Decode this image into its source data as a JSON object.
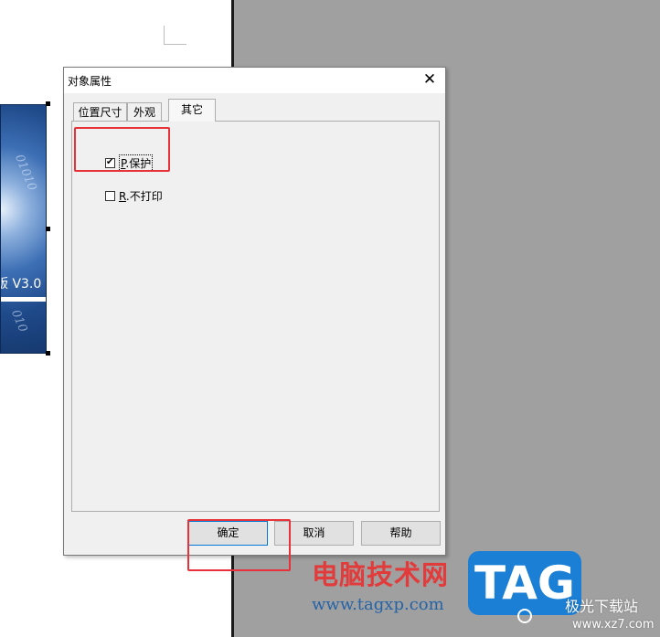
{
  "canvas": {
    "image_version_text": "版 V3.0",
    "image_digits_1": "01010",
    "image_digits_2": "010"
  },
  "dialog": {
    "title": "对象属性",
    "close_glyph": "✕",
    "tabs": [
      {
        "label": "位置尺寸"
      },
      {
        "label": "外观"
      },
      {
        "label": "其它"
      }
    ],
    "active_tab": "其它",
    "options": {
      "protect": {
        "accel": "P",
        "label": ".保护",
        "checked": true
      },
      "noprint": {
        "accel": "R",
        "label": ".不打印",
        "checked": false
      }
    },
    "buttons": {
      "ok": "确定",
      "cancel": "取消",
      "help": "帮助"
    }
  },
  "watermark": {
    "site_cn": "电脑技术网",
    "site_url": "www.tagxp.com",
    "tag_logo": "TAG",
    "site2_cn": "极光下载站",
    "site2_url": "www.xz7.com"
  },
  "colors": {
    "annotation": "#e8323a",
    "focus_border": "#0078d7",
    "tag_blue": "#1b7fd6"
  }
}
